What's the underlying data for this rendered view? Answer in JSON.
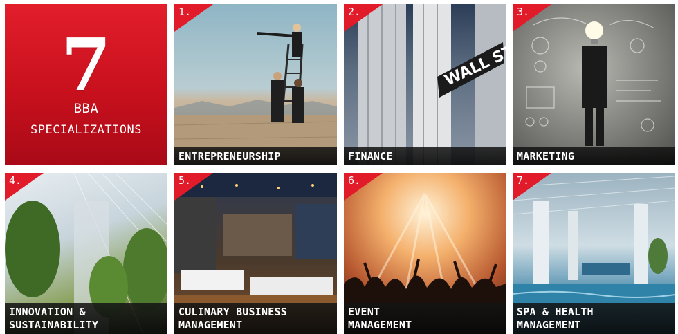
{
  "hero": {
    "number": "7",
    "line1": "BBA",
    "line2": "SPECIALIZATIONS",
    "color": "#d0121f"
  },
  "tiles": [
    {
      "num": "1.",
      "caption": [
        "ENTREPRENEURSHIP"
      ],
      "scene": "desert-telescope-ladder"
    },
    {
      "num": "2.",
      "caption": [
        "FINANCE"
      ],
      "scene": "wall-street-columns"
    },
    {
      "num": "3.",
      "caption": [
        "MARKETING"
      ],
      "scene": "lightbulb-head-chalkboard"
    },
    {
      "num": "4.",
      "caption": [
        "INNOVATION &",
        "SUSTAINABILITY"
      ],
      "scene": "glass-atrium-trees"
    },
    {
      "num": "5.",
      "caption": [
        "CULINARY BUSINESS",
        "MANAGEMENT"
      ],
      "scene": "restaurant-interior"
    },
    {
      "num": "6.",
      "caption": [
        "EVENT",
        "MANAGEMENT"
      ],
      "scene": "concert-crowd"
    },
    {
      "num": "7.",
      "caption": [
        "SPA & HEALTH",
        "MANAGEMENT"
      ],
      "scene": "indoor-pool"
    }
  ],
  "accent": "#e11b2a"
}
